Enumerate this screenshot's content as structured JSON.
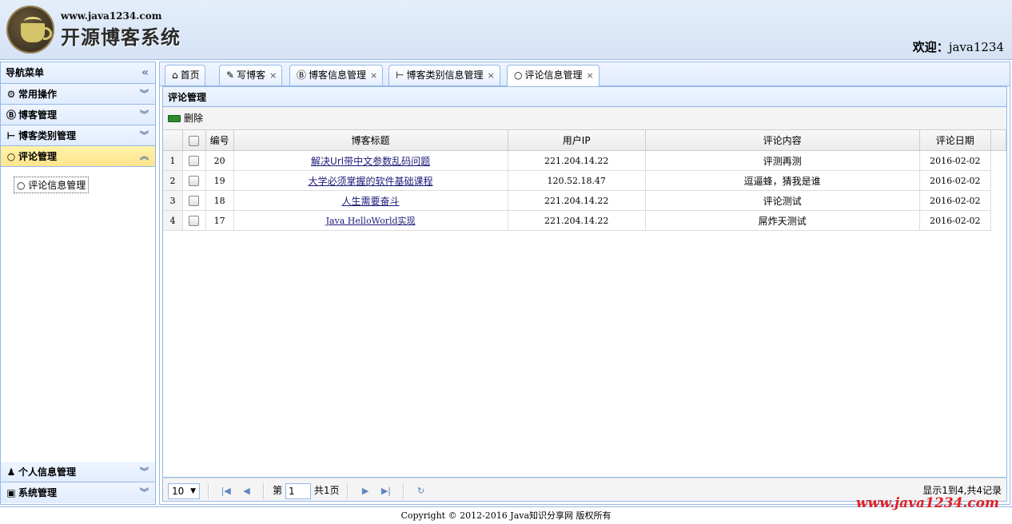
{
  "header": {
    "site_url": "www.java1234.com",
    "site_name": "开源博客系统",
    "welcome_label": "欢迎：",
    "welcome_user": "java1234"
  },
  "sidebar": {
    "title": "导航菜单",
    "sections": [
      {
        "label": "常用操作",
        "icon": "gear-icon"
      },
      {
        "label": "博客管理",
        "icon": "blog-icon"
      },
      {
        "label": "博客类别管理",
        "icon": "tree-icon"
      },
      {
        "label": "评论管理",
        "icon": "comment-icon",
        "active": true
      }
    ],
    "active_items": [
      "评论信息管理"
    ],
    "bottom_sections": [
      {
        "label": "个人信息管理",
        "icon": "user-icon"
      },
      {
        "label": "系统管理",
        "icon": "settings-icon"
      }
    ]
  },
  "tabs": [
    {
      "label": "首页",
      "icon": "home-icon",
      "closable": false
    },
    {
      "label": "写博客",
      "icon": "edit-icon",
      "closable": true
    },
    {
      "label": "博客信息管理",
      "icon": "blog-icon",
      "closable": true
    },
    {
      "label": "博客类别信息管理",
      "icon": "tree-icon",
      "closable": true
    },
    {
      "label": "评论信息管理",
      "icon": "comment-icon",
      "closable": true,
      "active": true
    }
  ],
  "panel": {
    "title": "评论管理",
    "toolbar_delete": "删除"
  },
  "grid": {
    "columns": [
      "编号",
      "博客标题",
      "用户IP",
      "评论内容",
      "评论日期"
    ],
    "rows": [
      {
        "rn": "1",
        "id": "20",
        "title": "解决Url带中文参数乱码问题",
        "ip": "221.204.14.22",
        "content": "评测再测",
        "date": "2016-02-02"
      },
      {
        "rn": "2",
        "id": "19",
        "title": "大学必须掌握的软件基础课程",
        "ip": "120.52.18.47",
        "content": "逗逼蜂，猜我是谁",
        "date": "2016-02-02"
      },
      {
        "rn": "3",
        "id": "18",
        "title": "人生需要奋斗",
        "ip": "221.204.14.22",
        "content": "评论测试",
        "date": "2016-02-02"
      },
      {
        "rn": "4",
        "id": "17",
        "title": "Java HelloWorld实现",
        "ip": "221.204.14.22",
        "content": "屌炸天测试",
        "date": "2016-02-02"
      }
    ]
  },
  "pager": {
    "page_size": "10",
    "page_prefix": "第",
    "page_number": "1",
    "page_total": "共1页",
    "info": "显示1到4,共4记录"
  },
  "footer": {
    "copyright": "Copyright © 2012-2016 Java知识分享网 版权所有",
    "watermark": "www.java1234.com"
  }
}
